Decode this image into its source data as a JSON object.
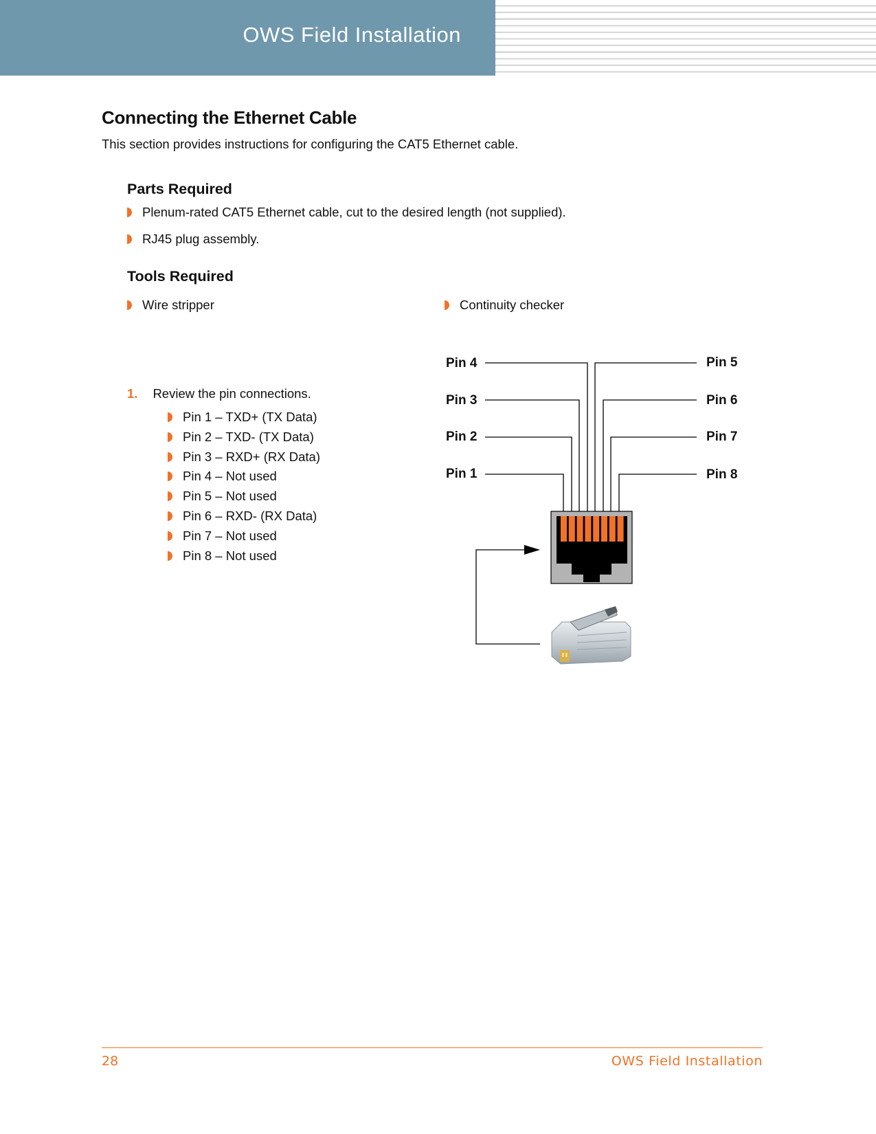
{
  "header": {
    "title": "OWS Field Installation",
    "bar_color": "#6f98ad"
  },
  "section": {
    "title": "Connecting the Ethernet Cable",
    "intro": "This section provides instructions for configuring the CAT5 Ethernet cable."
  },
  "parts_required": {
    "heading": "Parts Required",
    "items": [
      "Plenum-rated CAT5 Ethernet cable, cut to the desired length (not supplied).",
      "RJ45 plug assembly."
    ]
  },
  "tools_required": {
    "heading": "Tools Required",
    "items": [
      "Wire stripper",
      "Continuity checker"
    ]
  },
  "steps": [
    {
      "number": "1.",
      "text": "Review the pin connections.",
      "pins": [
        "Pin 1 – TXD+ (TX Data)",
        "Pin 2 – TXD- (TX Data)",
        "Pin 3 – RXD+ (RX Data)",
        "Pin 4 – Not used",
        "Pin 5 – Not used",
        "Pin 6 – RXD- (RX Data)",
        "Pin 7 – Not used",
        "Pin 8 – Not used"
      ]
    }
  ],
  "diagram": {
    "left_labels": [
      "Pin 4",
      "Pin 3",
      "Pin 2",
      "Pin 1"
    ],
    "right_labels": [
      "Pin 5",
      "Pin 6",
      "Pin 7",
      "Pin 8"
    ],
    "contact_color": "#f07327",
    "jack_body_color": "#b3b3b3",
    "jack_icon": "rj45-jack-icon",
    "plug_icon": "rj45-plug-icon",
    "arrow_icon": "arrow-right-icon"
  },
  "footer": {
    "page_number": "28",
    "title": "OWS Field Installation",
    "accent_color": "#f07327"
  }
}
